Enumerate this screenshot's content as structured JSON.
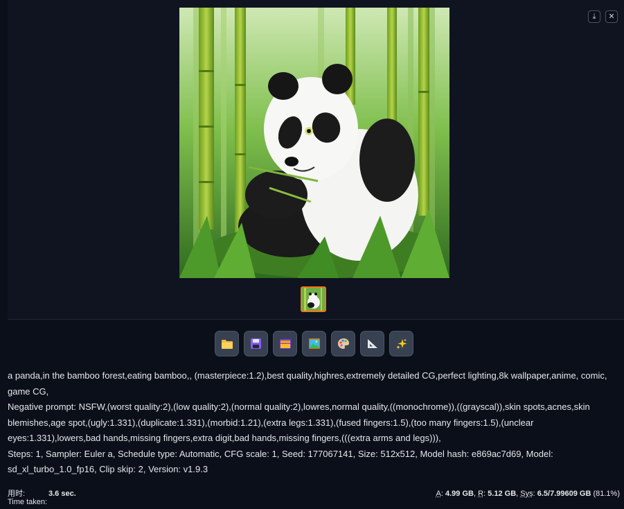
{
  "gallery": {
    "download_icon": "download-icon",
    "close_icon": "close-icon",
    "download_symbol": "⤓",
    "close_symbol": "✕"
  },
  "toolbar": {
    "buttons": [
      {
        "name": "open-folder-button",
        "icon": "folder-icon",
        "symbol": "📁"
      },
      {
        "name": "save-button",
        "icon": "floppy-disk-icon",
        "symbol": "💾"
      },
      {
        "name": "zip-button",
        "icon": "archive-icon",
        "symbol": "🗃"
      },
      {
        "name": "send-to-img2img-button",
        "icon": "picture-icon",
        "symbol": "🖼"
      },
      {
        "name": "send-to-inpaint-button",
        "icon": "palette-icon",
        "symbol": "🎨"
      },
      {
        "name": "send-to-extras-button",
        "icon": "triangle-ruler-icon",
        "symbol": "📐"
      },
      {
        "name": "upscale-button",
        "icon": "sparkles-icon",
        "symbol": "✨"
      }
    ]
  },
  "info": {
    "prompt": "a panda,in the bamboo forest,eating bamboo,, (masterpiece:1.2),best quality,highres,extremely detailed CG,perfect lighting,8k wallpaper,anime, comic, game CG,",
    "negative": "Negative prompt: NSFW,(worst quality:2),(low quality:2),(normal quality:2),lowres,normal quality,((monochrome)),((grayscal)),skin spots,acnes,skin blemishes,age spot,(ugly:1.331),(duplicate:1.331),(morbid:1.21),(extra legs:1.331),(fused fingers:1.5),(too many fingers:1.5),(unclear eyes:1.331),lowers,bad hands,missing fingers,extra digit,bad hands,missing fingers,(((extra arms and legs))),",
    "params": "Steps: 1, Sampler: Euler a, Schedule type: Automatic, CFG scale: 1, Seed: 177067141, Size: 512x512, Model hash: e869ac7d69, Model: sd_xl_turbo_1.0_fp16, Clip skip: 2, Version: v1.9.3"
  },
  "footer": {
    "time_label_cn": "用时:",
    "time_label_en": "Time taken:",
    "time_value": "3.6 sec.",
    "a_label": "A",
    "a_value": "4.99 GB",
    "r_label": "R",
    "r_value": "5.12 GB",
    "sys_label": "Sys",
    "sys_value": "6.5/7.99609 GB",
    "sys_pct": "(81.1%)"
  }
}
